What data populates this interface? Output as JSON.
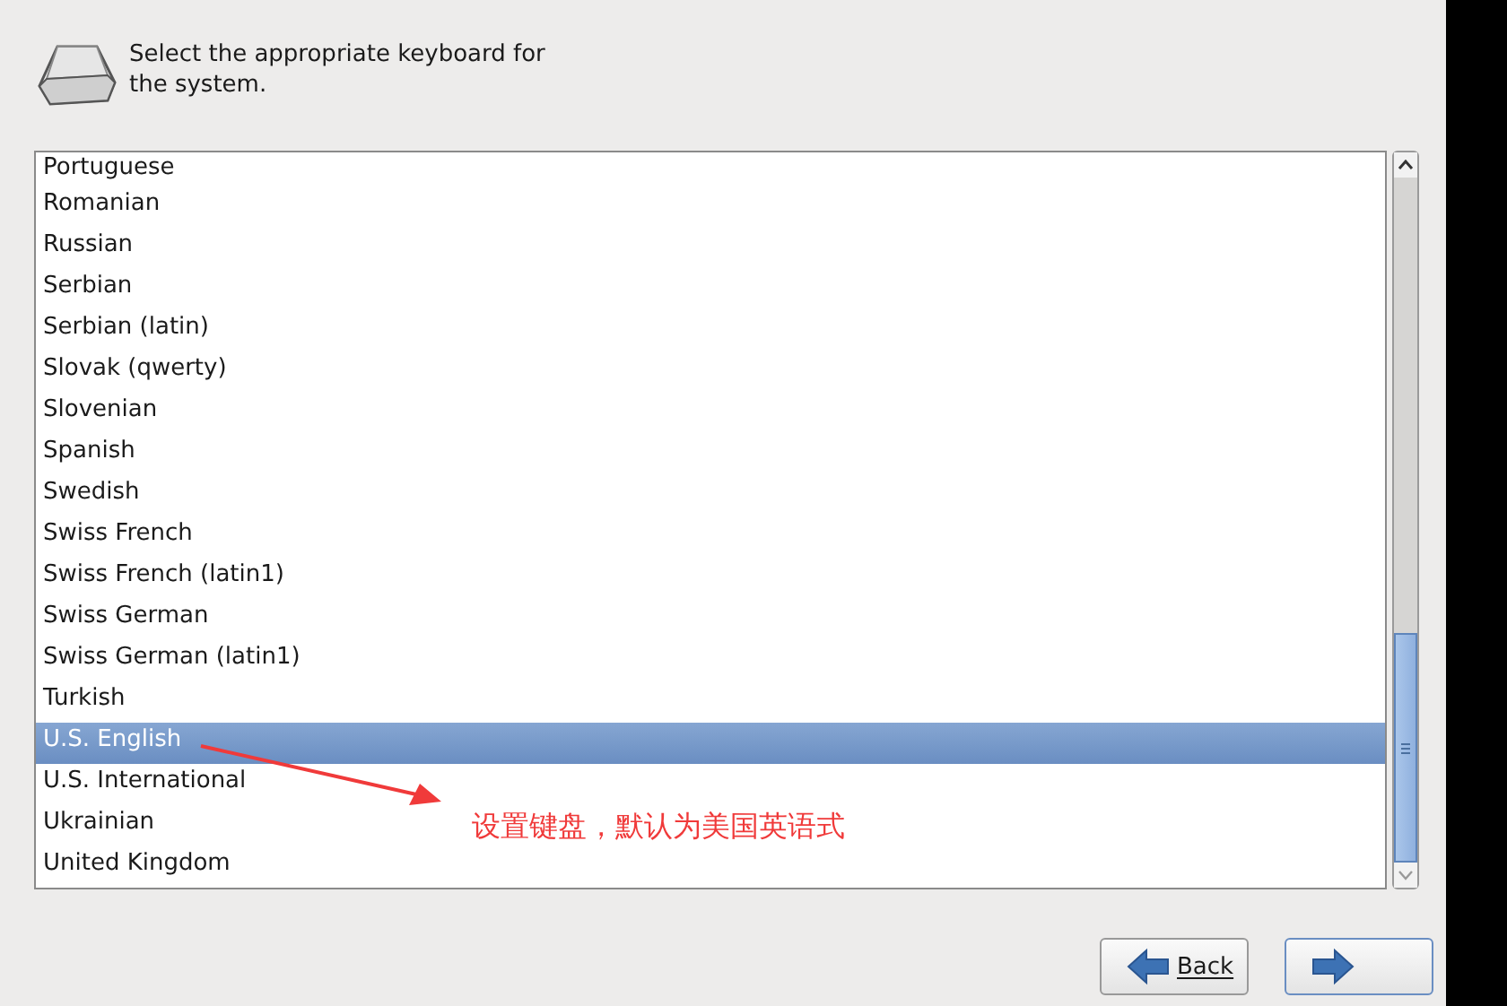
{
  "header": {
    "text": "Select the appropriate keyboard for the system."
  },
  "keyboards": [
    {
      "label": "Portuguese",
      "selected": false
    },
    {
      "label": "Romanian",
      "selected": false
    },
    {
      "label": "Russian",
      "selected": false
    },
    {
      "label": "Serbian",
      "selected": false
    },
    {
      "label": "Serbian (latin)",
      "selected": false
    },
    {
      "label": "Slovak (qwerty)",
      "selected": false
    },
    {
      "label": "Slovenian",
      "selected": false
    },
    {
      "label": "Spanish",
      "selected": false
    },
    {
      "label": "Swedish",
      "selected": false
    },
    {
      "label": "Swiss French",
      "selected": false
    },
    {
      "label": "Swiss French (latin1)",
      "selected": false
    },
    {
      "label": "Swiss German",
      "selected": false
    },
    {
      "label": "Swiss German (latin1)",
      "selected": false
    },
    {
      "label": "Turkish",
      "selected": false
    },
    {
      "label": "U.S. English",
      "selected": true
    },
    {
      "label": "U.S. International",
      "selected": false
    },
    {
      "label": "Ukrainian",
      "selected": false
    },
    {
      "label": "United Kingdom",
      "selected": false
    }
  ],
  "annotation": {
    "text": "设置键盘，默认为美国英语式"
  },
  "buttons": [
    {
      "kind": "back",
      "label": "Back"
    },
    {
      "kind": "next"
    }
  ]
}
